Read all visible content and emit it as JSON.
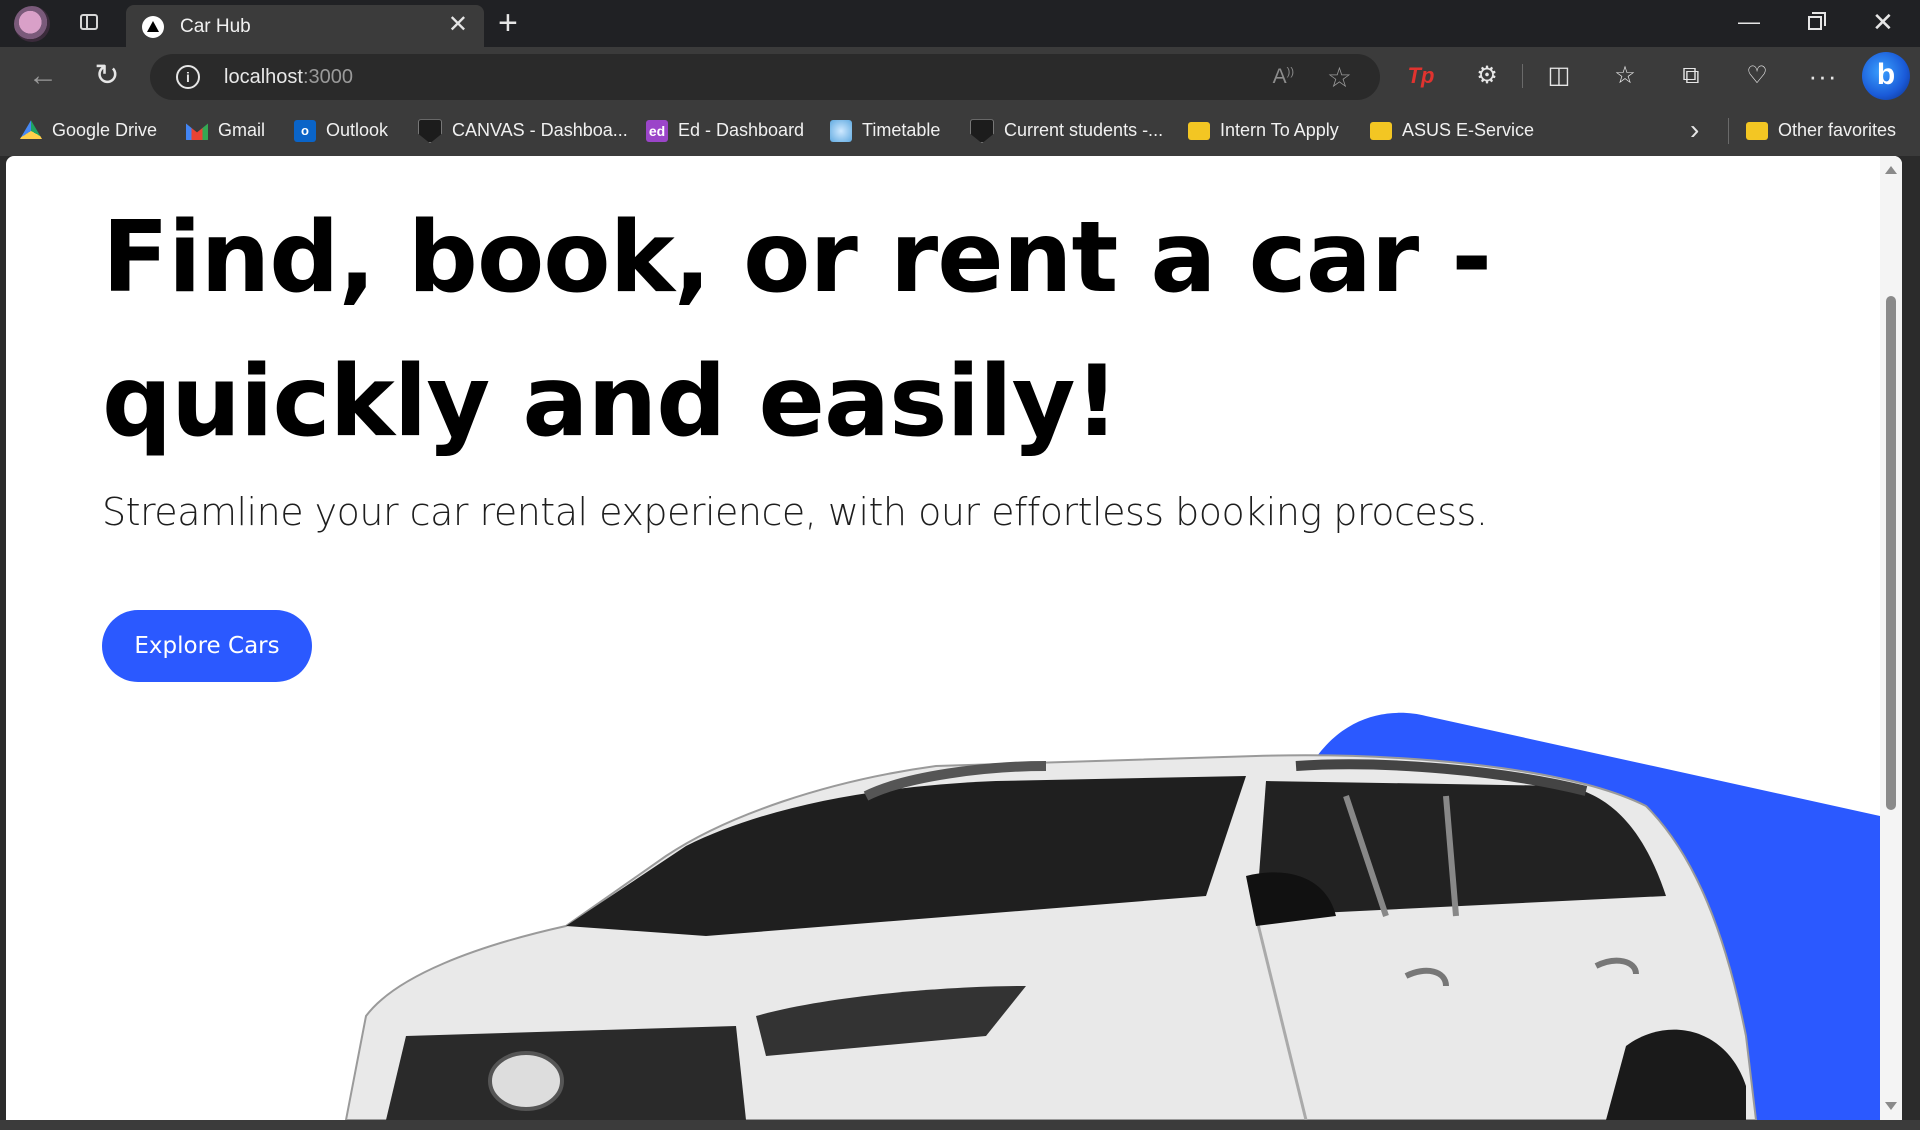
{
  "browser": {
    "tab_title": "Car Hub",
    "url_host": "localhost",
    "url_port": ":3000",
    "accent_color": "#2b59ff"
  },
  "bookmarks": [
    {
      "label": "Google Drive",
      "icon": "google-drive-icon"
    },
    {
      "label": "Gmail",
      "icon": "gmail-icon"
    },
    {
      "label": "Outlook",
      "icon": "outlook-icon"
    },
    {
      "label": "CANVAS - Dashboa...",
      "icon": "shield-icon"
    },
    {
      "label": "Ed - Dashboard",
      "icon": "ed-icon"
    },
    {
      "label": "Timetable",
      "icon": "timetable-icon"
    },
    {
      "label": "Current students -...",
      "icon": "shield-icon"
    },
    {
      "label": "Intern To Apply",
      "icon": "folder-icon"
    },
    {
      "label": "ASUS E-Service",
      "icon": "folder-icon"
    }
  ],
  "other_favorites": "Other favorites",
  "hero": {
    "title": "Find, book, or rent a car - quickly and easily!",
    "subtitle": "Streamline your car rental experience, with our effortless booking process.",
    "cta_label": "Explore Cars",
    "image": "white-suv-car"
  }
}
